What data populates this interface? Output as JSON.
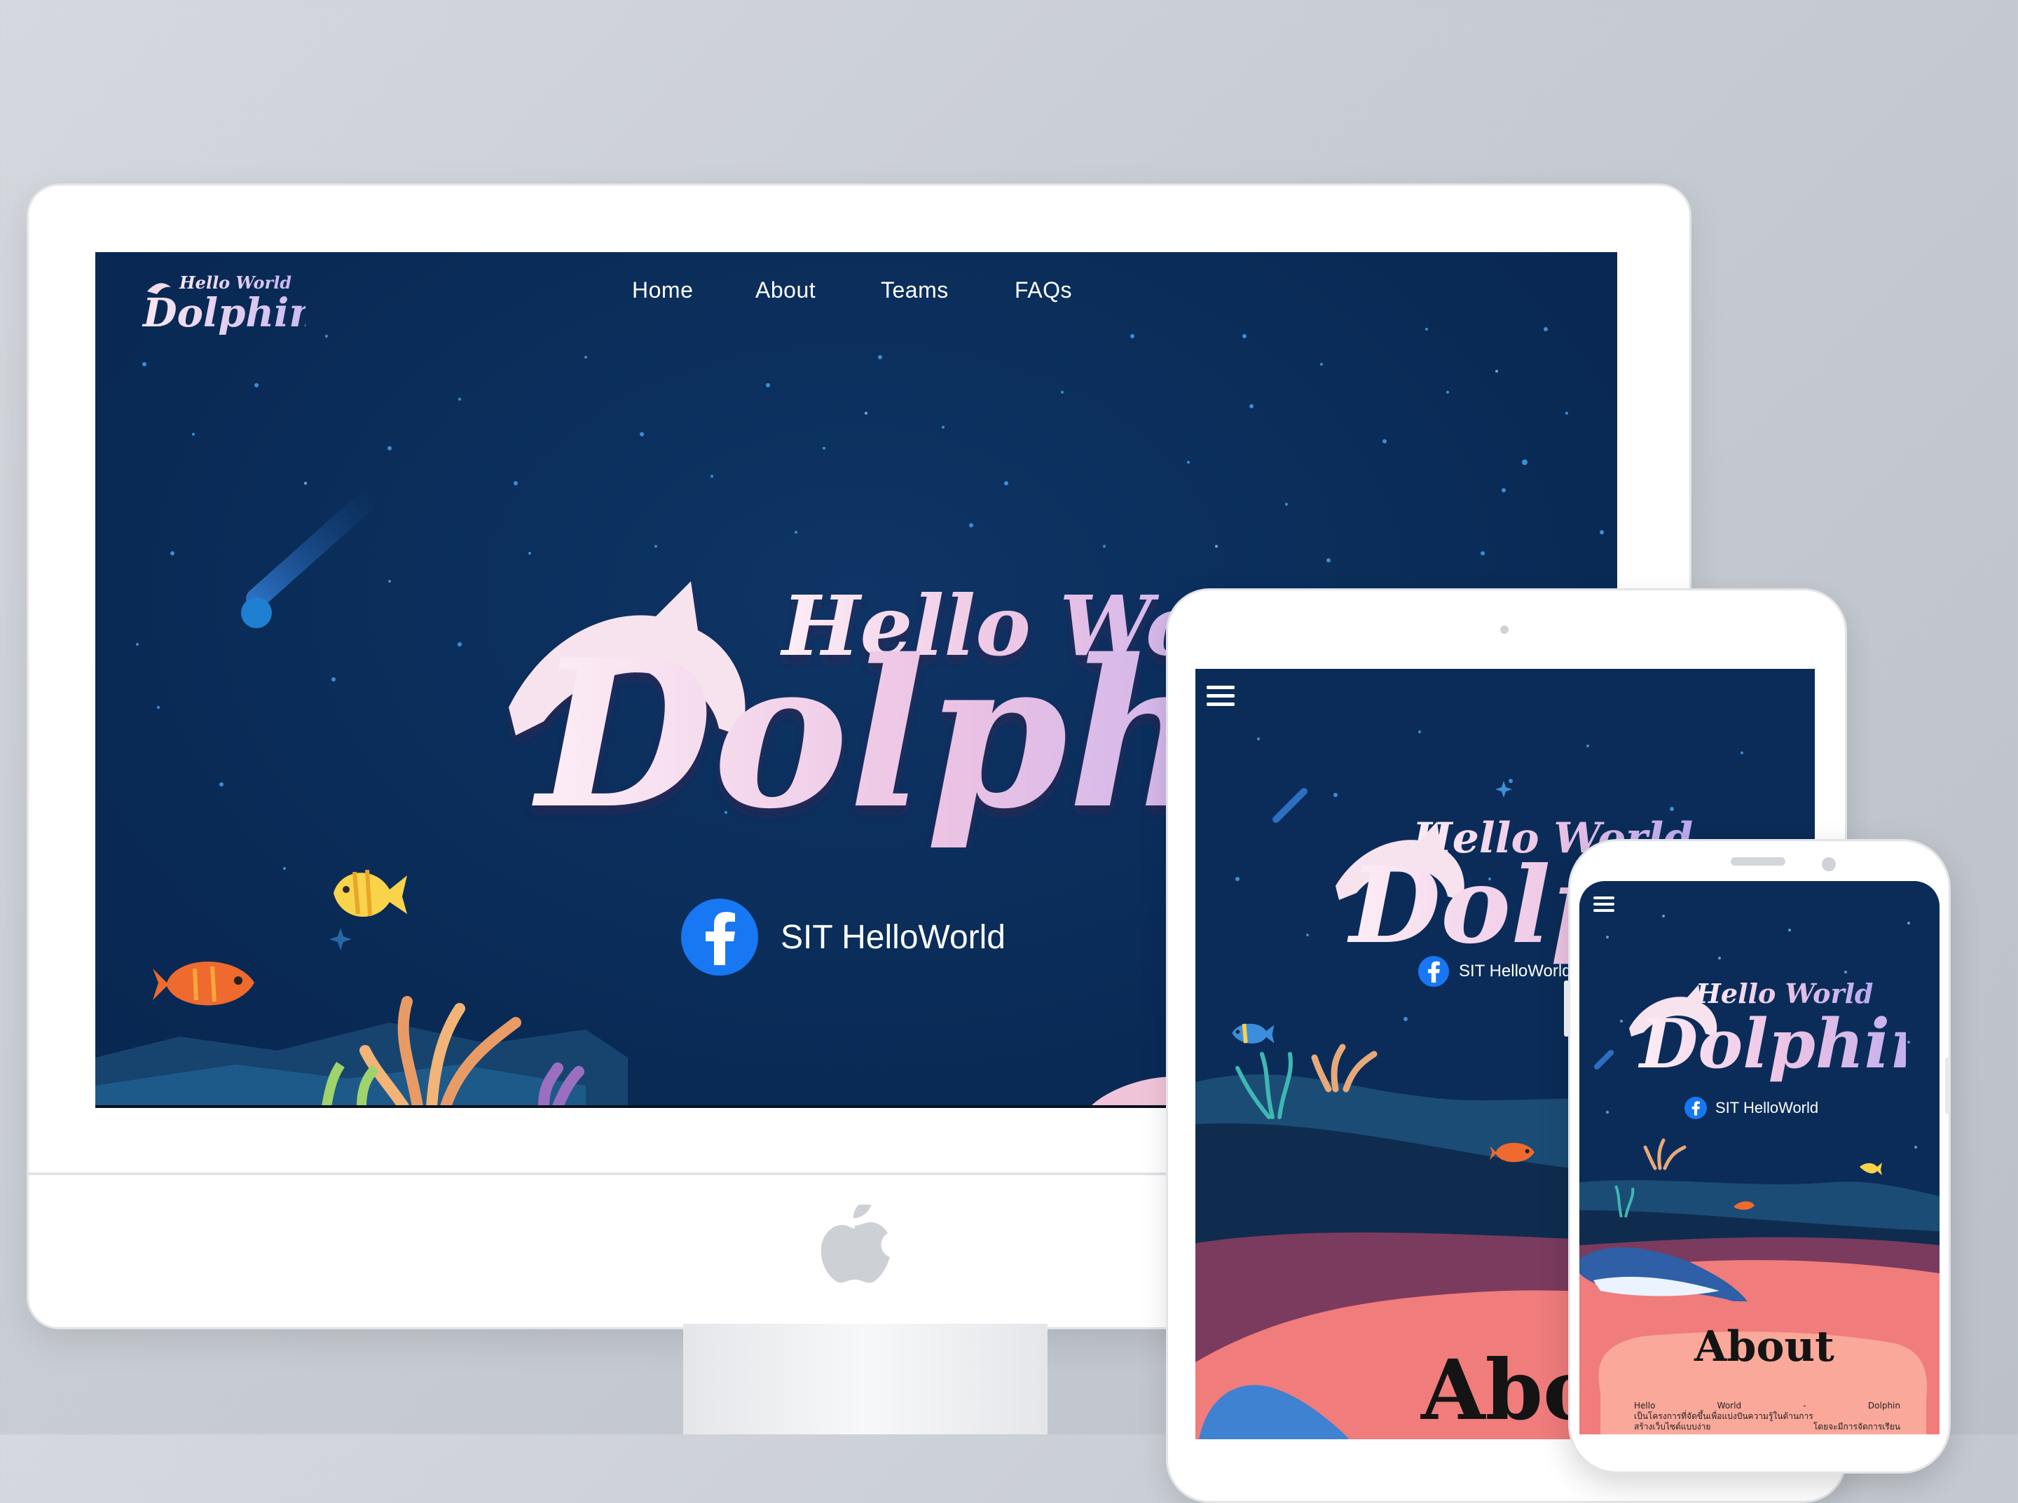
{
  "nav": {
    "items": [
      {
        "label": "Home"
      },
      {
        "label": "About"
      },
      {
        "label": "Teams"
      },
      {
        "label": "FAQs"
      }
    ]
  },
  "hero": {
    "facebook_label": "SIT HelloWorld"
  },
  "about": {
    "tablet_title": "Abo",
    "phone_title": "About",
    "phone_body": {
      "line1_words": [
        "Hello",
        "World",
        "-",
        "Dolphin"
      ],
      "line2": "เป็นโครงการที่จัดขึ้นเพื่อแบ่งปันความรู้ในด้านการ",
      "line3_left": "สร้างเว็บไซต์แบบง่าย",
      "line3_right": "โดยจะมีการจัดการเรียน"
    }
  },
  "colors": {
    "night_sky": "#0a2c58",
    "facebook": "#1877f2",
    "sand": "#f07c7c",
    "dune": "#7b3b5e"
  },
  "icons": [
    "dolphin-logo-icon",
    "facebook-icon",
    "hamburger-menu-icon",
    "apple-logo-icon"
  ]
}
